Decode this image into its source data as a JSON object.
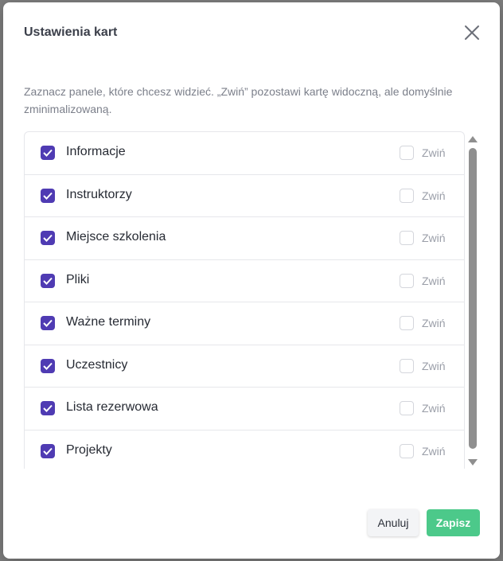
{
  "modal": {
    "title": "Ustawienia kart",
    "description": "Zaznacz panele, które chcesz widzieć. „Zwiń” pozostawi kartę widoczną, ale domyślnie zminimalizowaną.",
    "collapse_label": "Zwiń",
    "panels": [
      {
        "label": "Informacje",
        "visible": true,
        "collapsed": false
      },
      {
        "label": "Instruktorzy",
        "visible": true,
        "collapsed": false
      },
      {
        "label": "Miejsce szkolenia",
        "visible": true,
        "collapsed": false
      },
      {
        "label": "Pliki",
        "visible": true,
        "collapsed": false
      },
      {
        "label": "Ważne terminy",
        "visible": true,
        "collapsed": false
      },
      {
        "label": "Uczestnicy",
        "visible": true,
        "collapsed": false
      },
      {
        "label": "Lista rezerwowa",
        "visible": true,
        "collapsed": false
      },
      {
        "label": "Projekty",
        "visible": true,
        "collapsed": false
      }
    ],
    "buttons": {
      "cancel_label": "Anuluj",
      "save_label": "Zapisz"
    },
    "colors": {
      "checkbox_checked": "#4f3bb3",
      "save_button": "#4cc98a"
    }
  }
}
